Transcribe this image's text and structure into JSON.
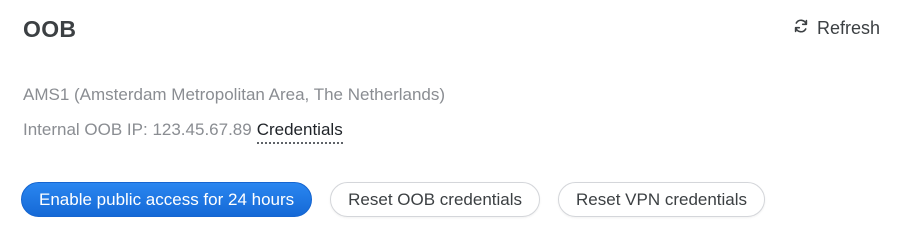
{
  "panel": {
    "title": "OOB",
    "refresh_label": "Refresh",
    "refresh_icon": "refresh-icon"
  },
  "info": {
    "location": "AMS1 (Amsterdam Metropolitan Area, The Netherlands)",
    "oob_ip_label": "Internal OOB IP: 123.45.67.89",
    "credentials_link": "Credentials"
  },
  "actions": {
    "enable_public_access": "Enable public access for 24 hours",
    "reset_oob_credentials": "Reset OOB credentials",
    "reset_vpn_credentials": "Reset VPN credentials"
  },
  "colors": {
    "primary": "#1a73e8",
    "title": "#3c4043",
    "muted_text": "#8a8d92"
  }
}
